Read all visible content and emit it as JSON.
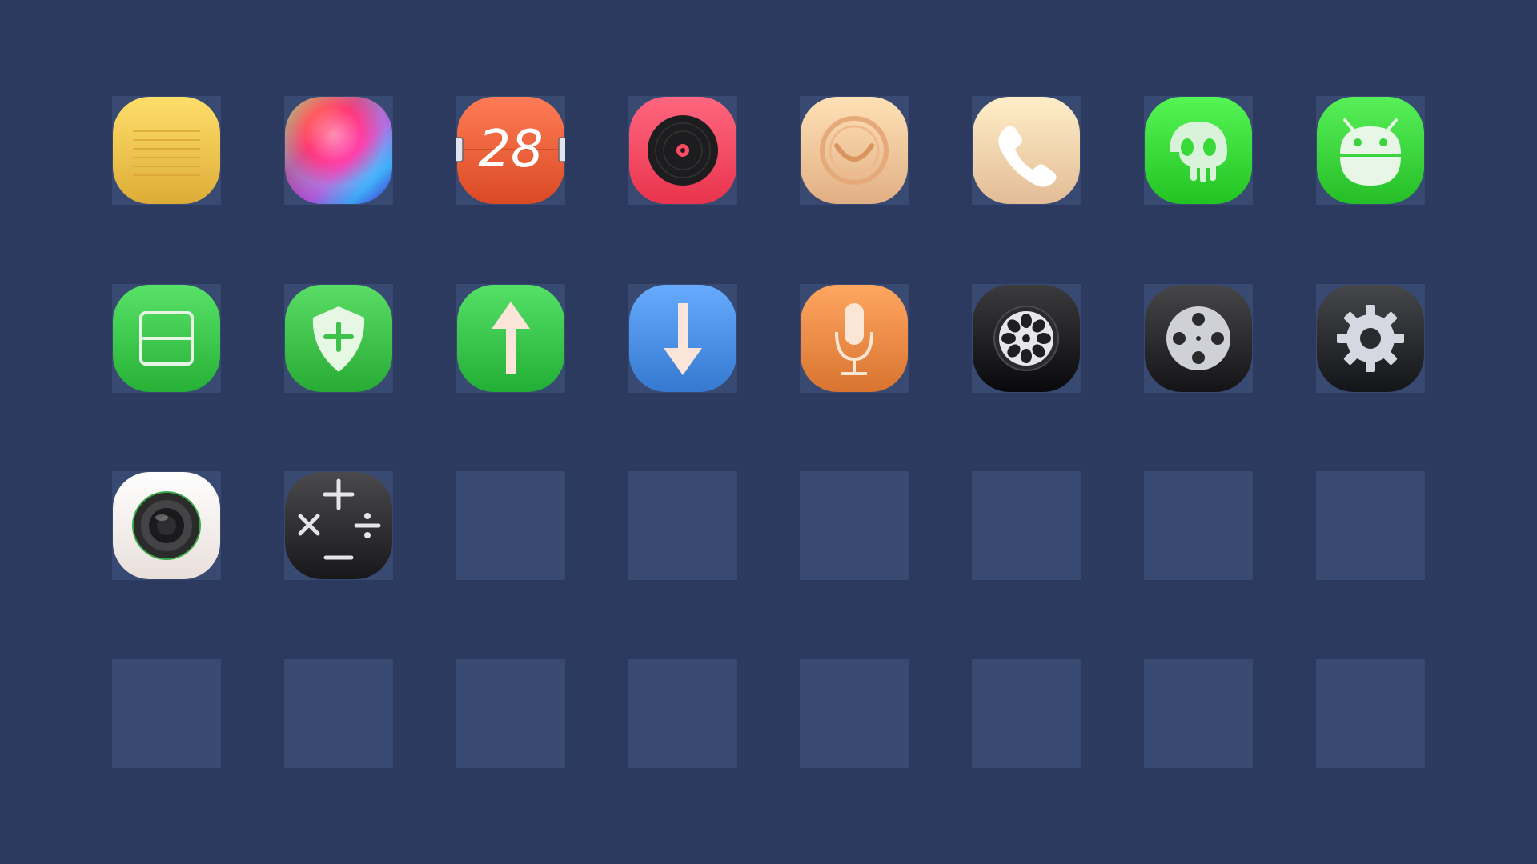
{
  "screen": {
    "background": "#2c3a60",
    "slot_color": "#384a72",
    "columns": 8,
    "rows": 4
  },
  "icons": [
    {
      "name": "notes-icon",
      "kind": "notes",
      "color": "#f3c24e"
    },
    {
      "name": "color-palette-icon",
      "kind": "palette",
      "color": "#ff4fa0"
    },
    {
      "name": "calendar-icon",
      "kind": "calendar",
      "color": "#f0603a",
      "date": "28"
    },
    {
      "name": "music-vinyl-icon",
      "kind": "vinyl",
      "color": "#ff4a63"
    },
    {
      "name": "smiley-face-icon",
      "kind": "smiley",
      "color": "#f7c59a"
    },
    {
      "name": "phone-icon",
      "kind": "phone",
      "color": "#f8d2ac"
    },
    {
      "name": "jellyfish-icon",
      "kind": "jelly",
      "color": "#39d93a"
    },
    {
      "name": "android-icon",
      "kind": "android",
      "color": "#3bd43c"
    },
    {
      "name": "scanner-icon",
      "kind": "scanner",
      "color": "#3cc74c"
    },
    {
      "name": "shield-plus-icon",
      "kind": "shield",
      "color": "#3ec14a"
    },
    {
      "name": "upload-arrow-icon",
      "kind": "up",
      "color": "#39c44c"
    },
    {
      "name": "download-arrow-icon",
      "kind": "down",
      "color": "#4b8fe6"
    },
    {
      "name": "microphone-icon",
      "kind": "mic",
      "color": "#ee8a45"
    },
    {
      "name": "film-reel-icon",
      "kind": "reel",
      "color": "#1f1f22"
    },
    {
      "name": "video-reel-icon",
      "kind": "reel2",
      "color": "#2a2a2d"
    },
    {
      "name": "gear-icon",
      "kind": "gear",
      "color": "#2a2b2e"
    },
    {
      "name": "camera-icon",
      "kind": "camera",
      "color": "#fff5f0"
    },
    {
      "name": "calculator-icon",
      "kind": "calc",
      "color": "#2e2e30"
    }
  ]
}
